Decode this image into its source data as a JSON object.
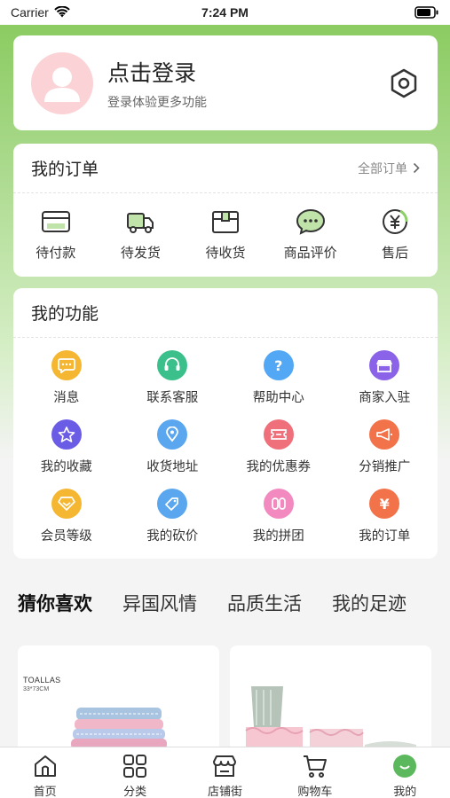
{
  "status_bar": {
    "carrier": "Carrier",
    "time": "7:24 PM"
  },
  "login": {
    "title": "点击登录",
    "subtitle": "登录体验更多功能"
  },
  "orders": {
    "title": "我的订单",
    "all_label": "全部订单",
    "items": [
      {
        "label": "待付款",
        "icon": "wallet-icon"
      },
      {
        "label": "待发货",
        "icon": "truck-icon"
      },
      {
        "label": "待收货",
        "icon": "package-icon"
      },
      {
        "label": "商品评价",
        "icon": "chat-icon"
      },
      {
        "label": "售后",
        "icon": "yen-refund-icon"
      }
    ]
  },
  "functions": {
    "title": "我的功能",
    "items": [
      {
        "label": "消息",
        "icon": "message-icon",
        "color": "#f5b731"
      },
      {
        "label": "联系客服",
        "icon": "headset-icon",
        "color": "#3cc08b"
      },
      {
        "label": "帮助中心",
        "icon": "question-icon",
        "color": "#52a8f4"
      },
      {
        "label": "商家入驻",
        "icon": "shop-icon",
        "color": "#8a63e8"
      },
      {
        "label": "我的收藏",
        "icon": "star-icon",
        "color": "#6b5ce6"
      },
      {
        "label": "收货地址",
        "icon": "location-icon",
        "color": "#5aa6ef"
      },
      {
        "label": "我的优惠券",
        "icon": "coupon-icon",
        "color": "#ef6f7b"
      },
      {
        "label": "分销推广",
        "icon": "megaphone-icon",
        "color": "#f2724a"
      },
      {
        "label": "会员等级",
        "icon": "vip-icon",
        "color": "#f5b731"
      },
      {
        "label": "我的砍价",
        "icon": "bargain-icon",
        "color": "#5aa6ef"
      },
      {
        "label": "我的拼团",
        "icon": "group-icon",
        "color": "#f28ac0"
      },
      {
        "label": "我的订单",
        "icon": "yen-icon",
        "color": "#f2724a"
      }
    ]
  },
  "tabs": [
    "猜你喜欢",
    "异国风情",
    "品质生活",
    "我的足迹"
  ],
  "products": [
    {
      "brand": "TOALLAS",
      "size": "33*73CM"
    }
  ],
  "bottom_nav": [
    {
      "label": "首页",
      "icon": "home-icon"
    },
    {
      "label": "分类",
      "icon": "grid-icon"
    },
    {
      "label": "店铺街",
      "icon": "store-icon"
    },
    {
      "label": "购物车",
      "icon": "cart-icon"
    },
    {
      "label": "我的",
      "icon": "profile-icon",
      "accent": "#5cb85c"
    }
  ]
}
